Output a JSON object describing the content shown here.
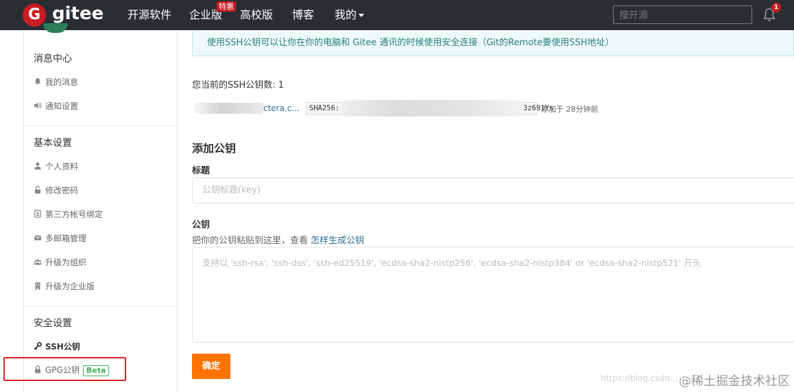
{
  "header": {
    "logo_letter": "G",
    "logo_text": "gitee",
    "nav": [
      "开源软件",
      "企业版",
      "高校版",
      "博客",
      "我的"
    ],
    "special_badge": "特惠",
    "search_placeholder": "搜开源",
    "notification_count": "1",
    "brand_color": "#c71d23"
  },
  "sidebar": {
    "sections": [
      {
        "title": "消息中心",
        "items": [
          {
            "label": "我的消息",
            "icon": "bell-icon"
          },
          {
            "label": "通知设置",
            "icon": "volume-icon"
          }
        ]
      },
      {
        "title": "基本设置",
        "items": [
          {
            "label": "个人资料",
            "icon": "user-icon"
          },
          {
            "label": "修改密码",
            "icon": "lock-icon"
          },
          {
            "label": "第三方帐号绑定",
            "icon": "id-card-icon"
          },
          {
            "label": "多邮箱管理",
            "icon": "envelope-icon"
          },
          {
            "label": "升级为组织",
            "icon": "group-icon"
          },
          {
            "label": "升级为企业版",
            "icon": "building-icon"
          }
        ]
      },
      {
        "title": "安全设置",
        "items": [
          {
            "label": "SSH公钥",
            "icon": "key-icon",
            "active": true
          },
          {
            "label": "GPG公钥",
            "icon": "lock-icon",
            "badge": "Beta"
          }
        ]
      }
    ]
  },
  "main": {
    "info": "使用SSH公钥可以让你在你的电脑和 Gitee 通讯的时候使用安全连接（Git的Remote要使用SSH地址）",
    "key_count_text": "您当前的SSH公钥数: 1",
    "key": {
      "name": "ctera.c...",
      "fingerprint_prefix": "SHA256:",
      "fingerprint_suffix": "3z691Ys",
      "added": "添加于 28分钟前"
    },
    "add_title": "添加公钥",
    "title_label": "标题",
    "title_placeholder": "公钥标题(key)",
    "key_label": "公钥",
    "key_hint": "把你的公钥粘贴到这里，查看 ",
    "key_hint_link": "怎样生成公钥",
    "key_placeholder": "支持以 'ssh-rsa', 'ssh-dss', 'ssh-ed25519', 'ecdsa-sha2-nistp256', 'ecdsa-sha2-nistp384' or 'ecdsa-sha2-nistp521' 开头",
    "submit": "确定"
  },
  "watermark": {
    "url": "https://blog.csdn...",
    "text": "@稀土掘金技术社区"
  }
}
